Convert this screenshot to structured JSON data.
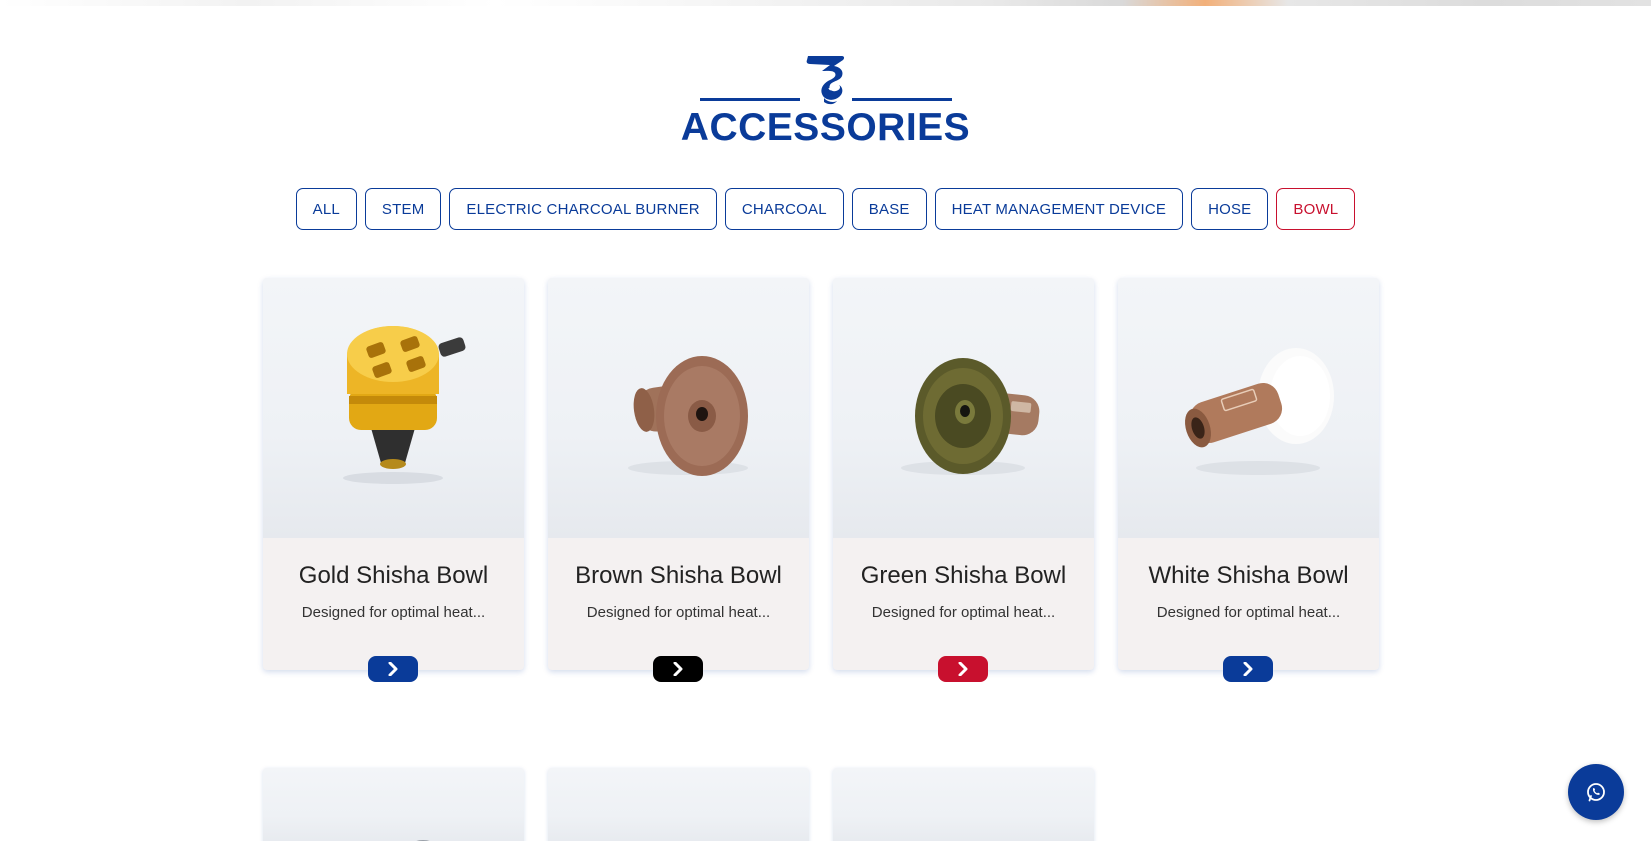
{
  "header": {
    "title": "ACCESSORIES",
    "brand_color": "#0a3b99",
    "logo_icon": "smoke-logo-icon"
  },
  "filters": [
    {
      "label": "ALL",
      "active": false
    },
    {
      "label": "STEM",
      "active": false
    },
    {
      "label": "ELECTRIC CHARCOAL BURNER",
      "active": false
    },
    {
      "label": "CHARCOAL",
      "active": false
    },
    {
      "label": "BASE",
      "active": false
    },
    {
      "label": "HEAT MANAGEMENT DEVICE",
      "active": false
    },
    {
      "label": "HOSE",
      "active": false
    },
    {
      "label": "BOWL",
      "active": true
    }
  ],
  "active_color": "#c8102e",
  "products": [
    {
      "name": "Gold Shisha Bowl",
      "description": "Designed for optimal heat...",
      "button_color": "#0a3b99",
      "button_icon": "chevron-right-icon"
    },
    {
      "name": "Brown Shisha Bowl",
      "description": "Designed for optimal heat...",
      "button_color": "#000000",
      "button_icon": "chevron-right-icon"
    },
    {
      "name": "Green Shisha Bowl",
      "description": "Designed for optimal heat...",
      "button_color": "#c8102e",
      "button_icon": "chevron-right-icon"
    },
    {
      "name": "White Shisha Bowl",
      "description": "Designed for optimal heat...",
      "button_color": "#0a3b99",
      "button_icon": "chevron-right-icon"
    }
  ],
  "floating": {
    "icon": "whatsapp-icon"
  }
}
